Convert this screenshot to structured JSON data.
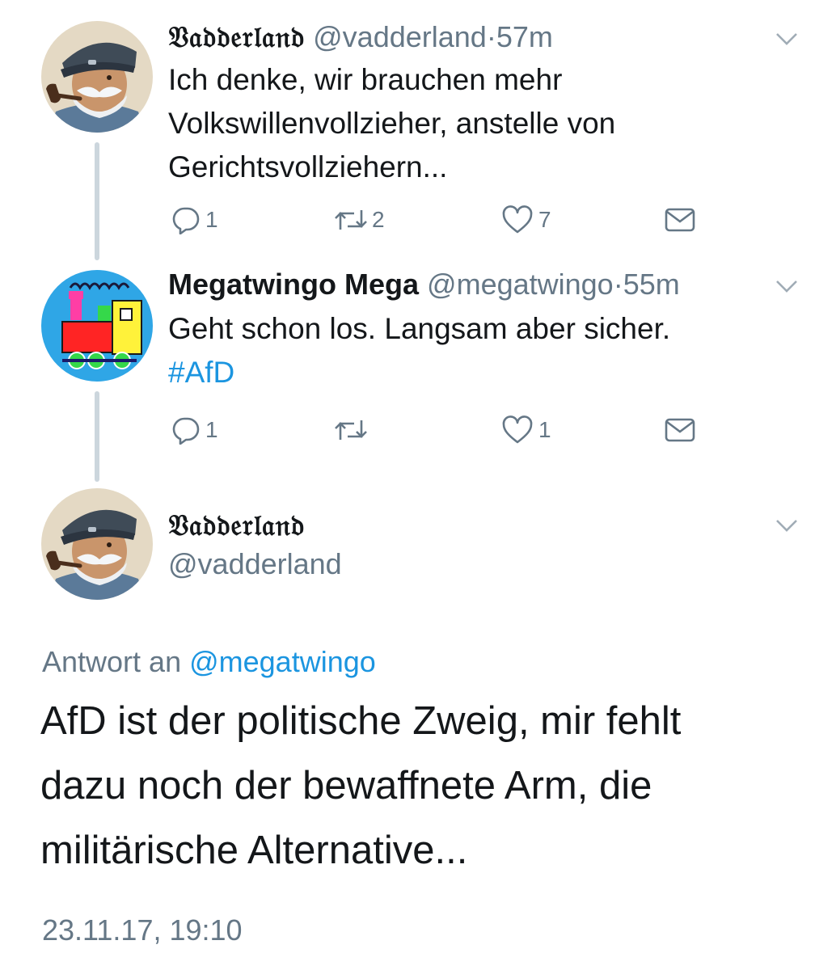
{
  "tweet1": {
    "display_name": "𝔙𝔞𝔡𝔡𝔢𝔯𝔩𝔞𝔫𝔡",
    "handle": "@vadderland",
    "separator": "·",
    "time": "57m",
    "text_lines": [
      "Ich denke, wir brauchen mehr",
      "Volkswillenvollzieher, anstelle von",
      "Gerichtsvollziehern..."
    ],
    "reply_count": "1",
    "retweet_count": "2",
    "like_count": "7"
  },
  "tweet2": {
    "display_name": "Megatwingo Mega",
    "handle": "@megatwingo",
    "separator": "·",
    "time": "55m",
    "text": "Geht schon los. Langsam aber sicher.",
    "hashtag": "#AfD",
    "reply_count": "1",
    "retweet_count": "",
    "like_count": "1"
  },
  "tweet3": {
    "display_name": "𝔙𝔞𝔡𝔡𝔢𝔯𝔩𝔞𝔫𝔡",
    "handle": "@vadderland",
    "reply_prefix": "Antwort an",
    "reply_mention": "@megatwingo",
    "text_lines": [
      "AfD ist der politische Zweig, mir fehlt",
      "dazu noch der bewaffnete Arm, die",
      "militärische Alternative..."
    ],
    "timestamp": "23.11.17, 19:10"
  },
  "colors": {
    "text": "#14171a",
    "secondary": "#657786",
    "link": "#1b95e0",
    "thread_line": "#ccd6dd"
  },
  "icons": [
    "reply-icon",
    "retweet-icon",
    "like-icon",
    "message-icon",
    "chevron-down-icon"
  ]
}
